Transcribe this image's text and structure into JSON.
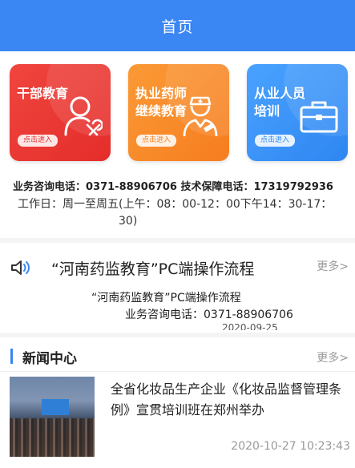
{
  "header": {
    "title": "首页"
  },
  "cards": [
    {
      "title": "干部教育",
      "enter": "点击进入",
      "icon": "cadre-party-icon"
    },
    {
      "title": "执业药师\n继续教育",
      "enter": "点击进入",
      "icon": "pharmacist-icon"
    },
    {
      "title": "从业人员\n培训",
      "enter": "点击进入",
      "icon": "briefcase-icon"
    }
  ],
  "contact": {
    "phone_line": "业务咨询电话：0371-88906706 技术保障电话：17319792936",
    "hours_a": "工作日：周一至周五",
    "hours_b": "(上午：08：00-12：00下午14：30-17：30)"
  },
  "notice": {
    "title": "“河南药监教育”PC端操作流程",
    "more": "更多>",
    "line1": "“河南药监教育”PC端操作流程",
    "line2": "业务咨询电话：0371-88906706",
    "line3": "2020-09-25"
  },
  "news": {
    "section_title": "新闻中心",
    "more": "更多>",
    "headline": "全省化妆品生产企业《化妆品监督管理条例》宣贯培训班在郑州举办",
    "time": "2020-10-27 10:23:43"
  },
  "colors": {
    "header": "#3a86f2",
    "red": "#e42d2a",
    "orange": "#f67d1f",
    "blue": "#2e86f1"
  }
}
